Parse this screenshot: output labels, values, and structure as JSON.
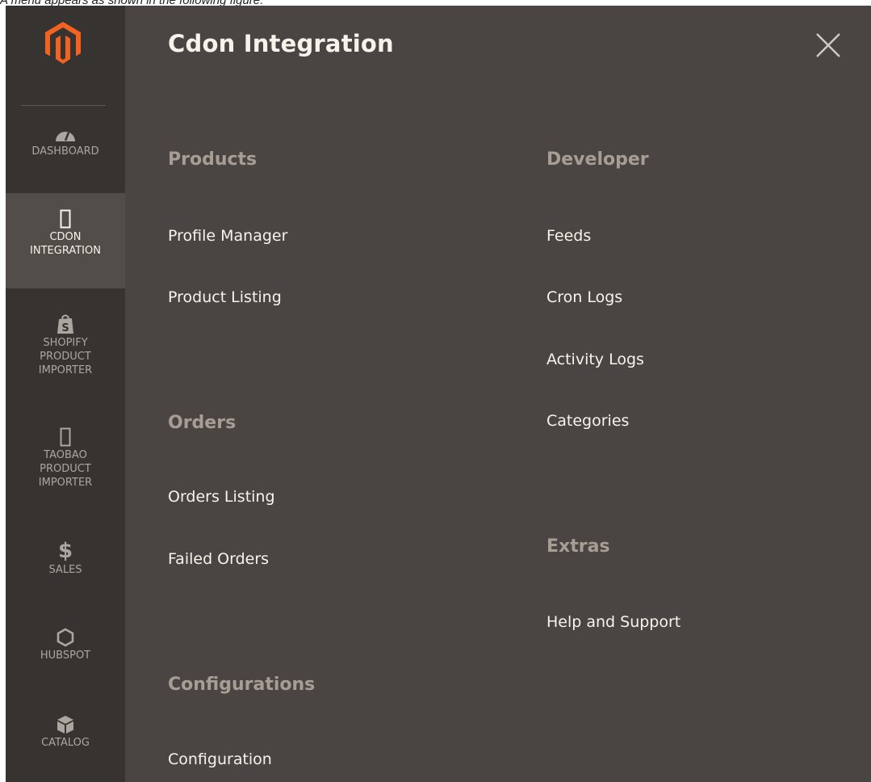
{
  "caption": "A menu appears as shown in the following figure:",
  "panel": {
    "title": "Cdon Integration",
    "close_icon": "close-icon"
  },
  "sidebar": {
    "logo": "magento-logo",
    "items": [
      {
        "label": "DASHBOARD",
        "icon": "dashboard-gauge-icon"
      },
      {
        "label": "CDON\nINTEGRATION",
        "icon": "placeholder-box-icon"
      },
      {
        "label": "SHOPIFY\nPRODUCT\nIMPORTER",
        "icon": "shopify-bag-icon"
      },
      {
        "label": "TAOBAO\nPRODUCT\nIMPORTER",
        "icon": "placeholder-box-icon"
      },
      {
        "label": "SALES",
        "icon": "dollar-icon"
      },
      {
        "label": "HUBSPOT",
        "icon": "hexagon-icon"
      },
      {
        "label": "CATALOG",
        "icon": "cube-icon"
      }
    ]
  },
  "menu": {
    "products": {
      "heading": "Products",
      "links": [
        "Profile Manager",
        "Product Listing"
      ]
    },
    "orders": {
      "heading": "Orders",
      "links": [
        "Orders Listing",
        "Failed Orders"
      ]
    },
    "configurations": {
      "heading": "Configurations",
      "links": [
        "Configuration"
      ]
    },
    "developer": {
      "heading": "Developer",
      "links": [
        "Feeds",
        "Cron Logs",
        "Activity Logs",
        "Categories"
      ]
    },
    "extras": {
      "heading": "Extras",
      "links": [
        "Help and Support"
      ]
    }
  },
  "colors": {
    "background": "#4a4542",
    "sidebar": "#373330",
    "sidebar_active": "#524d49",
    "logo": "#f26322",
    "heading": "#a79d95",
    "link": "#f7f3eb"
  }
}
